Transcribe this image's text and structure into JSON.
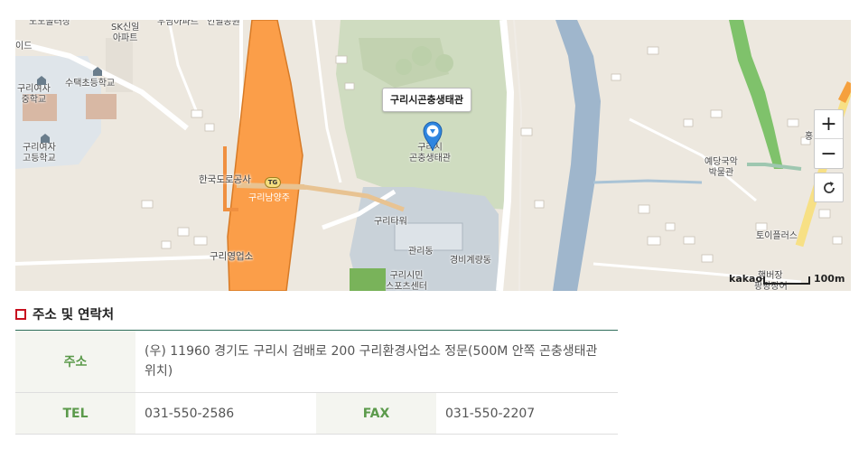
{
  "map": {
    "callout": "구리시곤충생태관",
    "labels": {
      "nodolgil": "노노돌러상",
      "sk": "SK신일\n아파트",
      "unam": "우남아파트",
      "park": "인필공원",
      "ide": "이드",
      "guri_girls_mid": "구리여자\n중학교",
      "sutaek_elem": "수택초등학교",
      "guri_girls_high": "구리여자\n고등학교",
      "korea_ex": "한국도로공사",
      "tg": "TG",
      "guri_namyangju": "구리남양주",
      "guri_sales": "구리영업소",
      "insect_center": "구리시\n곤충생태관",
      "guri_tower": "구리타워",
      "admin": "관리동",
      "guard": "경비계량동",
      "sports": "구리시민\n스포츠센터",
      "yedang": "예당국악\n박물관",
      "toi": "토이플러스",
      "hong": "홍",
      "hamburger": "햄버장",
      "papjang": "팡팡장어"
    },
    "controls": {
      "zoom_in": "+",
      "zoom_out": "−"
    },
    "scale": {
      "logo": "kakao",
      "distance": "100m"
    },
    "colors": {
      "land": "#ede8df",
      "park": "#cfdcc0",
      "water": "#9fb6cc",
      "expressway": "#fb9e49",
      "road": "#ffffff",
      "facility": "#c9d2d9"
    },
    "icons": [
      "location-marker-icon",
      "refresh-icon",
      "school-icon"
    ]
  },
  "section": {
    "title": "주소 및 연락처"
  },
  "contact": {
    "address_label": "주소",
    "address_value": "(우) 11960 경기도 구리시 검배로 200 구리환경사업소 정문(500M 안쪽 곤충생태관 위치)",
    "tel_label": "TEL",
    "tel_value": "031-550-2586",
    "fax_label": "FAX",
    "fax_value": "031-550-2207"
  }
}
